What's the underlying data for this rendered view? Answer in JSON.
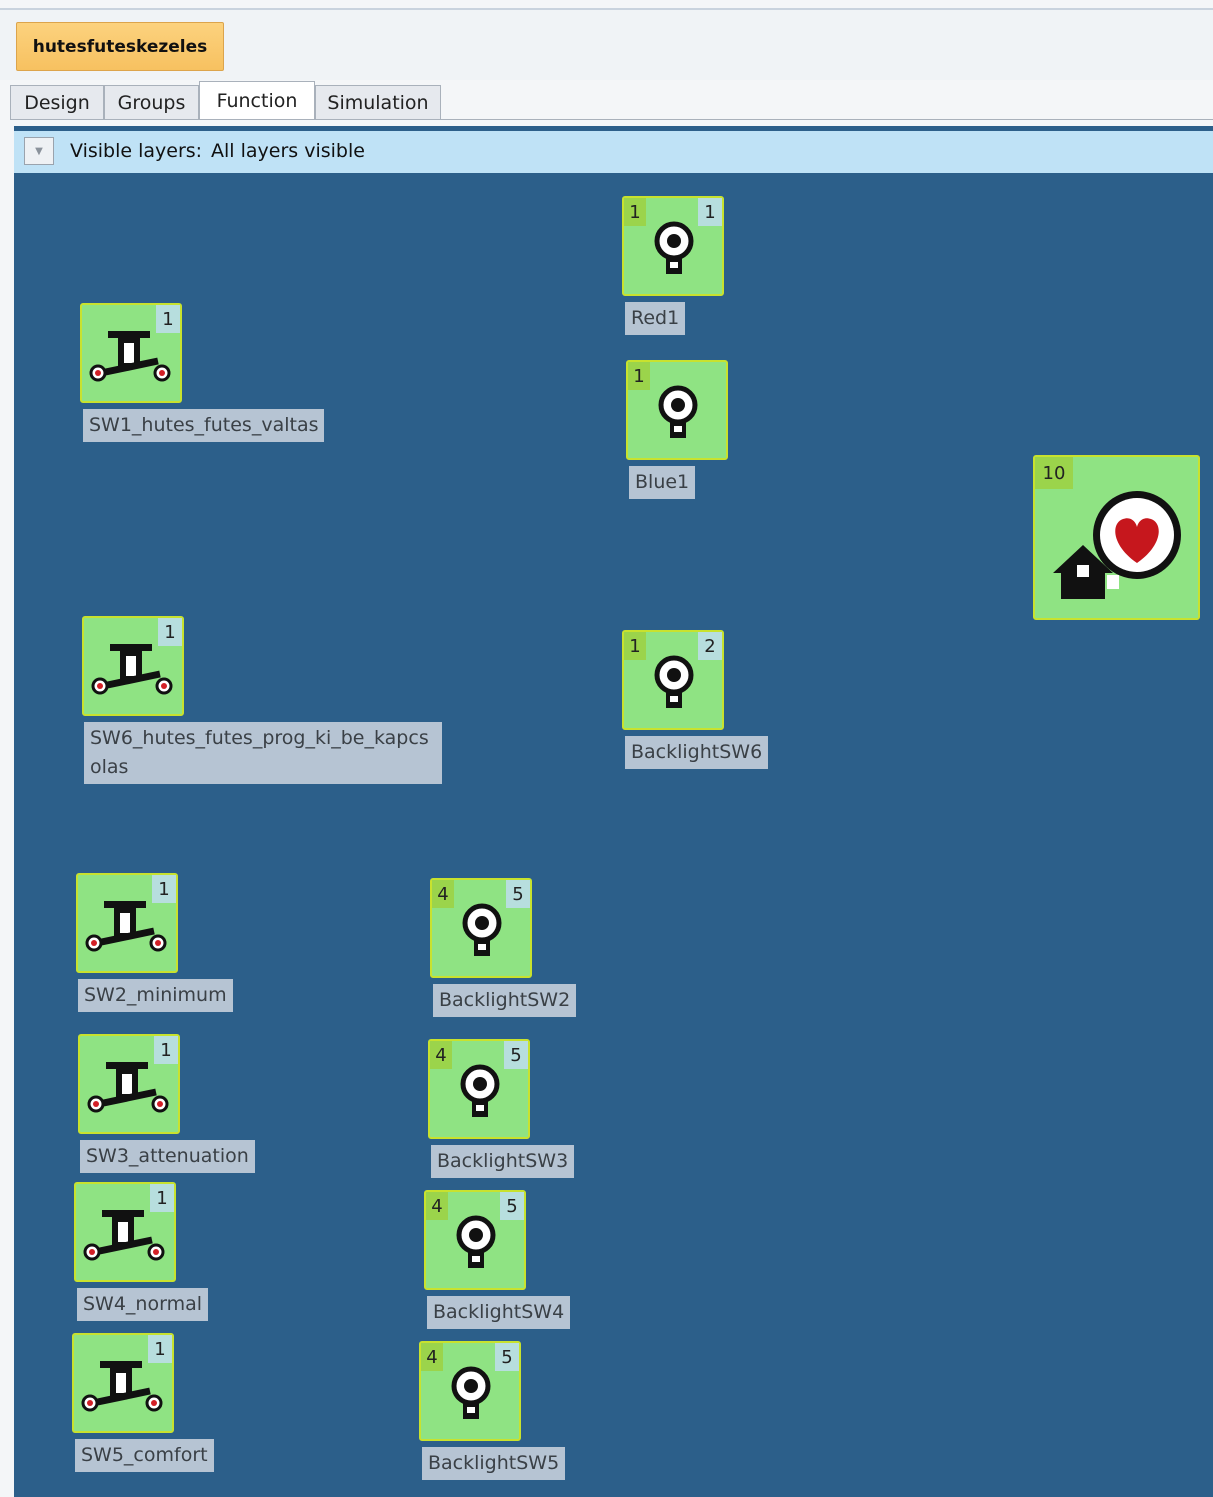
{
  "project": {
    "name": "hutesfuteskezeles"
  },
  "tabs": [
    {
      "label": "Design"
    },
    {
      "label": "Groups"
    },
    {
      "label": "Function"
    },
    {
      "label": "Simulation"
    }
  ],
  "layers": {
    "label": "Visible layers:",
    "value": "All layers visible"
  },
  "nodes": {
    "sw1": {
      "type": "switch",
      "right": "1",
      "caption": "SW1_hutes_futes_valtas"
    },
    "sw6": {
      "type": "switch",
      "right": "1",
      "caption": "SW6_hutes_futes_prog_ki_be_kapcs olas"
    },
    "sw2": {
      "type": "switch",
      "right": "1",
      "caption": "SW2_minimum"
    },
    "sw3": {
      "type": "switch",
      "right": "1",
      "caption": "SW3_attenuation"
    },
    "sw4": {
      "type": "switch",
      "right": "1",
      "caption": "SW4_normal"
    },
    "sw5": {
      "type": "switch",
      "right": "1",
      "caption": "SW5_comfort"
    },
    "red1": {
      "type": "lamp",
      "left": "1",
      "right": "1",
      "caption": "Red1"
    },
    "blue1": {
      "type": "lamp",
      "left": "1",
      "caption": "Blue1"
    },
    "bl6": {
      "type": "lamp",
      "left": "1",
      "right": "2",
      "caption": "BacklightSW6"
    },
    "bl2": {
      "type": "lamp",
      "left": "4",
      "right": "5",
      "caption": "BacklightSW2"
    },
    "bl3": {
      "type": "lamp",
      "left": "4",
      "right": "5",
      "caption": "BacklightSW3"
    },
    "bl4": {
      "type": "lamp",
      "left": "4",
      "right": "5",
      "caption": "BacklightSW4"
    },
    "bl5": {
      "type": "lamp",
      "left": "4",
      "right": "5",
      "caption": "BacklightSW5"
    },
    "home": {
      "type": "home-heart",
      "left": "10"
    }
  },
  "colors": {
    "canvas": "#2c5f8a",
    "node_fill": "#8fe383",
    "node_border": "#c8e22e",
    "badge_left": "#9bd44b",
    "badge_right": "#b7dede",
    "caption_bg": "#b6c4d3",
    "project_button": "#f7c160",
    "layer_bar": "#bfe2f6"
  },
  "icons": {
    "switch": "push-switch-icon",
    "lamp": "light-bulb-icon",
    "home": "home-heart-icon",
    "layer_toggle": "chevron-down-icon"
  }
}
